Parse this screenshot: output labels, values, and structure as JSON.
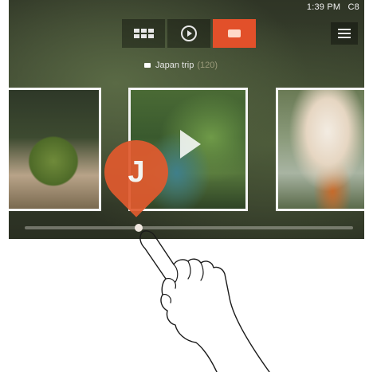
{
  "status_bar": {
    "time": "1:39 PM",
    "carrier": "C8"
  },
  "top_bar": {
    "modes": [
      {
        "name": "grid",
        "icon": "grid-icon",
        "active": false
      },
      {
        "name": "slideshow",
        "icon": "play-circle-icon",
        "active": false
      },
      {
        "name": "film",
        "icon": "film-icon",
        "active": true
      }
    ],
    "menu_icon": "menu-icon"
  },
  "album": {
    "title": "Japan trip",
    "count": "(120)"
  },
  "photos": [
    {
      "name": "moss-ball-photo"
    },
    {
      "name": "garden-video",
      "is_video": true
    },
    {
      "name": "cat-photo"
    }
  ],
  "scrubber": {
    "index_letter": "J",
    "position": 0.34
  },
  "colors": {
    "accent": "#e2502a",
    "bubble": "#e05a2e"
  }
}
